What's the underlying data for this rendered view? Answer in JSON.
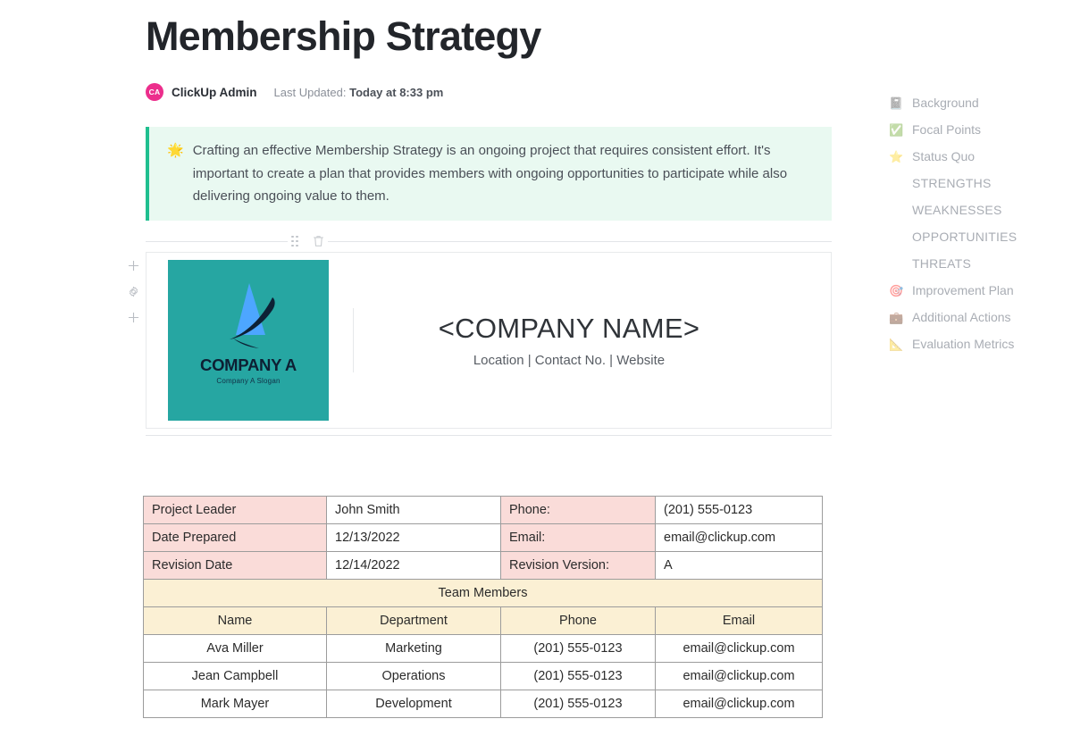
{
  "document": {
    "title": "Membership Strategy",
    "author": {
      "initials": "CA",
      "name": "ClickUp Admin",
      "avatar_color": "#ec2e8c"
    },
    "last_updated_label": "Last Updated:",
    "last_updated_value": "Today at 8:33 pm"
  },
  "callout": {
    "emoji": "🌟",
    "text": "Crafting an effective Membership Strategy is an ongoing project that requires consistent effort. It's important to create a plan that provides members with ongoing opportunities to participate while also delivering ongoing value to them.",
    "accent_color": "#1fbf8f",
    "background_color": "#e9f9f1"
  },
  "block_toolbar": {
    "drag_handle": "drag-handle-icon",
    "delete": "trash-icon"
  },
  "gutter": {
    "add_above": "+",
    "settings": "gear-icon",
    "add_below": "+",
    "drag_handle": "drag-handle-icon"
  },
  "header_block": {
    "logo": {
      "company_name": "COMPANY A",
      "slogan": "Company A Slogan",
      "background_color": "#26a6a2",
      "mark_primary": "#4da6ff",
      "mark_secondary": "#0d2135"
    },
    "company_name": "<COMPANY NAME>",
    "company_meta": "Location | Contact No. | Website"
  },
  "info_table": {
    "rows": [
      {
        "label1": "Project Leader",
        "value1": "John Smith",
        "label2": "Phone:",
        "value2": "(201) 555-0123"
      },
      {
        "label1": "Date Prepared",
        "value1": "12/13/2022",
        "label2": "Email:",
        "value2": "email@clickup.com"
      },
      {
        "label1": "Revision Date",
        "value1": "12/14/2022",
        "label2": "Revision Version:",
        "value2": "A"
      }
    ],
    "team_banner": "Team Members",
    "team_headers": [
      "Name",
      "Department",
      "Phone",
      "Email"
    ],
    "team_rows": [
      {
        "name": "Ava Miller",
        "department": "Marketing",
        "phone": "(201) 555-0123",
        "email": "email@clickup.com"
      },
      {
        "name": "Jean Campbell",
        "department": "Operations",
        "phone": "(201) 555-0123",
        "email": "email@clickup.com"
      },
      {
        "name": "Mark Mayer",
        "department": "Development",
        "phone": "(201) 555-0123",
        "email": "email@clickup.com"
      }
    ],
    "label_color": "#fadcd9",
    "team_color": "#fbf0d4"
  },
  "outline": {
    "items": [
      {
        "icon": "📓",
        "icon_name": "notebook-icon",
        "label": "Background",
        "style": "icon"
      },
      {
        "icon": "✅",
        "icon_name": "check-box-icon",
        "label": "Focal Points",
        "style": "icon"
      },
      {
        "icon": "⭐",
        "icon_name": "star-icon",
        "label": "Status Quo",
        "style": "icon"
      },
      {
        "icon": "",
        "icon_name": "",
        "label": "STRENGTHS",
        "style": "caps"
      },
      {
        "icon": "",
        "icon_name": "",
        "label": "WEAKNESSES",
        "style": "caps"
      },
      {
        "icon": "",
        "icon_name": "",
        "label": "OPPORTUNITIES",
        "style": "caps"
      },
      {
        "icon": "",
        "icon_name": "",
        "label": "THREATS",
        "style": "caps"
      },
      {
        "icon": "🎯",
        "icon_name": "target-icon",
        "label": "Improvement Plan",
        "style": "icon"
      },
      {
        "icon": "💼",
        "icon_name": "briefcase-icon",
        "label": "Additional Actions",
        "style": "icon"
      },
      {
        "icon": "📐",
        "icon_name": "triangular-ruler-icon",
        "label": "Evaluation Metrics",
        "style": "icon"
      }
    ]
  }
}
